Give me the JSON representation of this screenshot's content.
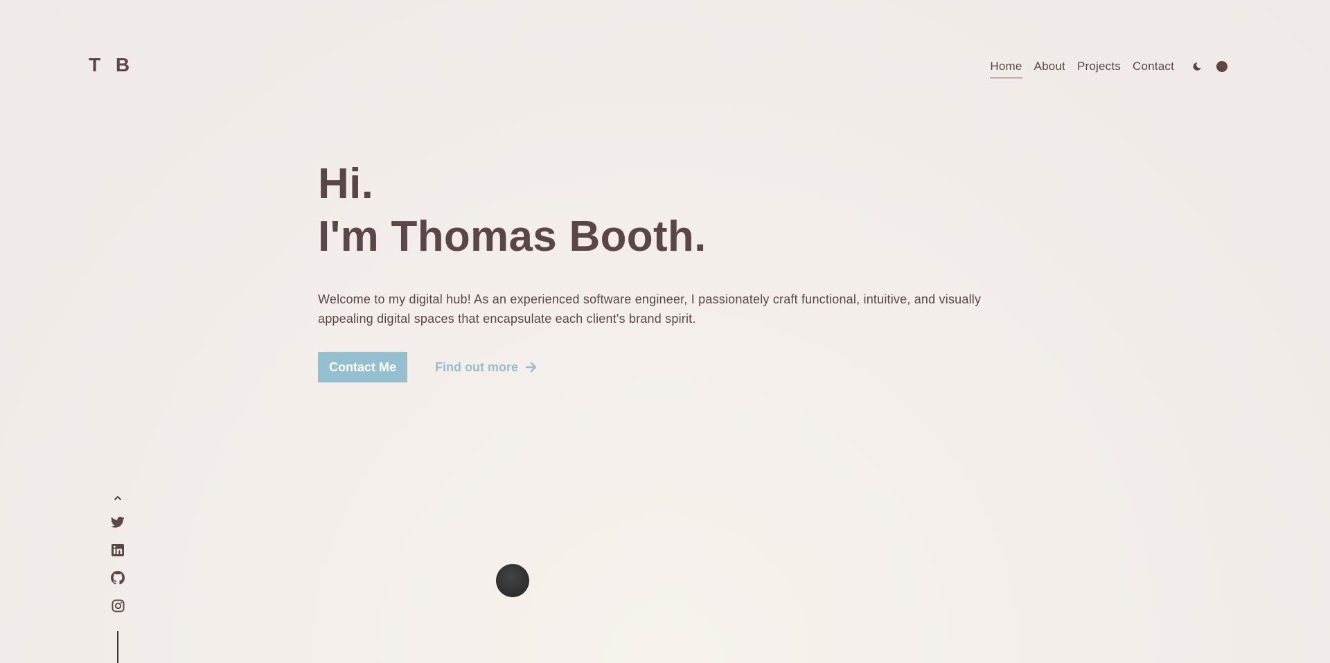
{
  "logo": {
    "text": "T B"
  },
  "nav": {
    "items": [
      {
        "label": "Home",
        "active": true
      },
      {
        "label": "About",
        "active": false
      },
      {
        "label": "Projects",
        "active": false
      },
      {
        "label": "Contact",
        "active": false
      }
    ],
    "theme_toggle_icon": "moon-icon",
    "color_dot_icon": "color-picker-dot"
  },
  "hero": {
    "greeting": "Hi.",
    "name_line": "I'm Thomas Booth.",
    "intro": "Welcome to my digital hub! As an experienced software engineer, I passionately craft functional, intuitive, and visually appealing digital spaces that encapsulate each client's brand spirit.",
    "primary_button": "Contact Me",
    "secondary_link": "Find out more"
  },
  "social": {
    "icons": [
      "chevron-up-icon",
      "twitter-icon",
      "linkedin-icon",
      "github-icon",
      "instagram-icon"
    ]
  },
  "colors": {
    "text": "#5a4646",
    "accent": "#94bfcf",
    "background": "#f3eeea"
  }
}
